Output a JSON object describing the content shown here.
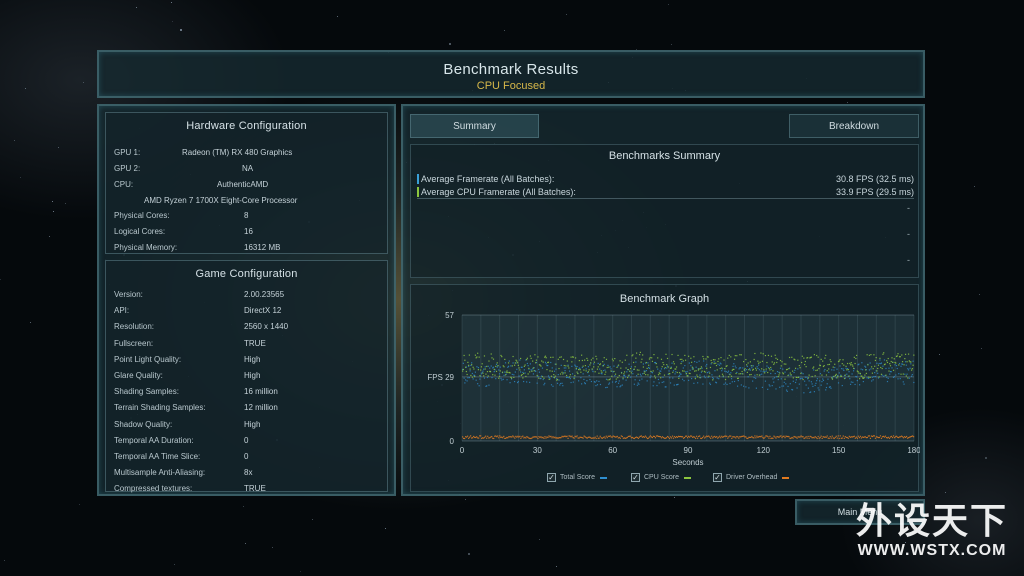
{
  "header": {
    "title": "Benchmark Results",
    "subtitle": "CPU Focused"
  },
  "hardware": {
    "title": "Hardware Configuration",
    "gpu1_label": "GPU 1:",
    "gpu1_value": "Radeon (TM) RX 480 Graphics",
    "gpu2_label": "GPU 2:",
    "gpu2_value": "NA",
    "cpu_label": "CPU:",
    "cpu_vendor": "AuthenticAMD",
    "cpu_model": "AMD Ryzen 7 1700X Eight-Core Processor",
    "physical_cores_label": "Physical Cores:",
    "physical_cores_value": "8",
    "logical_cores_label": "Logical Cores:",
    "logical_cores_value": "16",
    "physical_memory_label": "Physical Memory:",
    "physical_memory_value": "16312  MB"
  },
  "game": {
    "title": "Game Configuration",
    "rows": [
      {
        "label": "Version:",
        "value": "2.00.23565"
      },
      {
        "label": "API:",
        "value": "DirectX 12"
      },
      {
        "label": "Resolution:",
        "value": "2560 x 1440"
      },
      {
        "label": "Fullscreen:",
        "value": "TRUE"
      },
      {
        "label": "Point Light Quality:",
        "value": "High"
      },
      {
        "label": "Glare Quality:",
        "value": "High"
      },
      {
        "label": "Shading Samples:",
        "value": "16 million"
      },
      {
        "label": "Terrain Shading Samples:",
        "value": "12 million"
      },
      {
        "label": "Shadow Quality:",
        "value": "High"
      },
      {
        "label": "Temporal AA Duration:",
        "value": "0"
      },
      {
        "label": "Temporal AA Time Slice:",
        "value": "0"
      },
      {
        "label": "Multisample Anti-Aliasing:",
        "value": "8x"
      },
      {
        "label": "Compressed textures:",
        "value": "TRUE"
      }
    ]
  },
  "tabs": {
    "summary": "Summary",
    "breakdown": "Breakdown"
  },
  "summary": {
    "title": "Benchmarks Summary",
    "rows": [
      {
        "label": "Average Framerate (All Batches):",
        "value": "30.8 FPS (32.5 ms)",
        "color": "#3aa0d8"
      },
      {
        "label": "Average CPU Framerate (All Batches):",
        "value": "33.9 FPS (29.5 ms)",
        "color": "#8cc63f"
      }
    ],
    "dashes": [
      "-",
      "-",
      "-"
    ]
  },
  "graph": {
    "title": "Benchmark Graph",
    "y_max_label": "57",
    "y_mid_label": "FPS 29",
    "y_min_label": "0",
    "x_label": "Seconds",
    "x_ticks": [
      "0",
      "30",
      "60",
      "90",
      "120",
      "150",
      "180"
    ],
    "legend": [
      {
        "label": "Total Score",
        "color": "#2f8fd0",
        "check": "✓"
      },
      {
        "label": "CPU Score",
        "color": "#8cc63f",
        "check": "✓"
      },
      {
        "label": "Driver Overhead",
        "color": "#e07a20",
        "check": "✓"
      }
    ]
  },
  "chart_data": {
    "type": "scatter",
    "title": "Benchmark Graph",
    "xlabel": "Seconds",
    "ylabel": "FPS",
    "xlim": [
      0,
      180
    ],
    "ylim": [
      0,
      57
    ],
    "x_ticks": [
      0,
      30,
      60,
      90,
      120,
      150,
      180
    ],
    "y_ticks": [
      0,
      29,
      57
    ],
    "series": [
      {
        "name": "Total Score",
        "color": "#2f8fd0",
        "x": [
          0,
          10,
          20,
          30,
          40,
          50,
          60,
          70,
          80,
          90,
          100,
          110,
          120,
          130,
          140,
          150,
          160,
          170,
          180
        ],
        "y": [
          31,
          30,
          32,
          31,
          30,
          31,
          29,
          31,
          30,
          32,
          31,
          30,
          29,
          28,
          27,
          29,
          31,
          32,
          31
        ]
      },
      {
        "name": "CPU Score",
        "color": "#8cc63f",
        "x": [
          0,
          10,
          20,
          30,
          40,
          50,
          60,
          70,
          80,
          90,
          100,
          110,
          120,
          130,
          140,
          150,
          160,
          170,
          180
        ],
        "y": [
          34,
          35,
          33,
          34,
          33,
          34,
          33,
          35,
          34,
          34,
          33,
          34,
          35,
          33,
          34,
          33,
          34,
          35,
          34
        ]
      },
      {
        "name": "Driver Overhead",
        "color": "#e07a20",
        "x": [
          0,
          10,
          20,
          30,
          40,
          50,
          60,
          70,
          80,
          90,
          100,
          110,
          120,
          130,
          140,
          150,
          160,
          170,
          180
        ],
        "y": [
          2,
          2,
          2,
          2,
          2,
          2,
          2,
          2,
          2,
          2,
          2,
          2,
          2,
          2,
          2,
          2,
          2,
          2,
          2
        ]
      }
    ],
    "grid": true,
    "legend_position": "bottom"
  },
  "footer": {
    "main_menu": "Main Menu"
  },
  "watermark": {
    "big": "外设天下",
    "small": "WWW.WSTX.COM"
  }
}
